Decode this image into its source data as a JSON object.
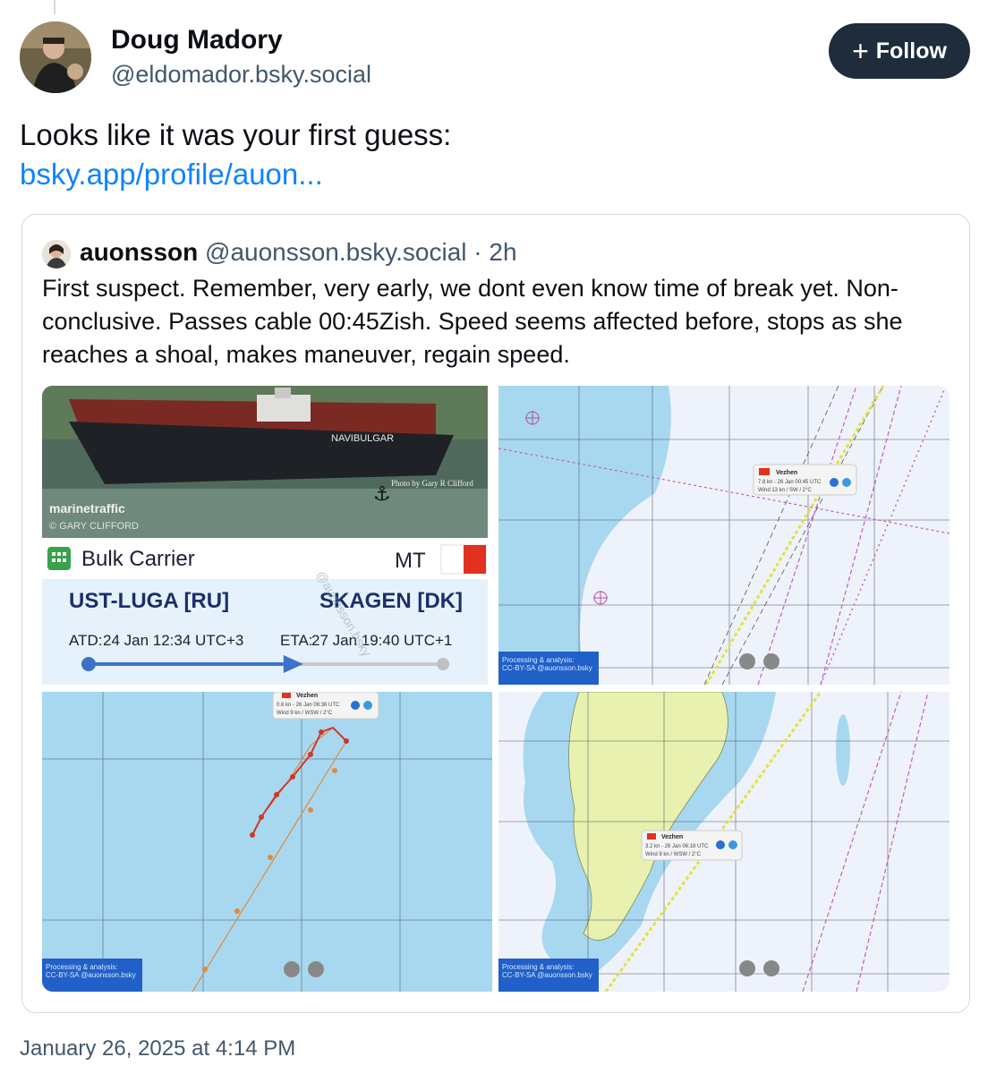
{
  "post": {
    "author_name": "Doug Madory",
    "author_handle": "@eldomador.bsky.social",
    "follow_label": "Follow",
    "text": "Looks like it was your first guess:",
    "link_text": "bsky.app/profile/auon...",
    "timestamp": "January 26, 2025 at 4:14 PM"
  },
  "quote": {
    "author_name": "auonsson",
    "author_handle": "@auonsson.bsky.social",
    "separator": "·",
    "time": "2h",
    "text": "First suspect. Remember, very early, we dont even know time of break yet. Non-conclusive. Passes cable 00:45Zish. Speed seems affected before, stops as she reaches a shoal, makes maneuver, regain speed."
  },
  "images": {
    "ship_card": {
      "watermark": "marinetraffic",
      "photo_credit": "© GARY CLIFFORD",
      "photo_sign": "Photo by Gary R Clifford",
      "hull_name": "NAVIBULGAR",
      "vessel_type": "Bulk Carrier",
      "flag_code": "MT",
      "origin": "UST-LUGA [RU]",
      "destination": "SKAGEN [DK]",
      "atd_label": "ATD:",
      "atd_value": "24 Jan 12:34 UTC+3",
      "eta_label": "ETA:",
      "eta_value": "27 Jan 19:40 UTC+1",
      "overlay_watermark": "@auonsson.bsky",
      "progress": 0.55,
      "flag_color": "#e0321e"
    },
    "map1": {
      "vessel": "Vezhen",
      "line1": "7.8 kn - 26 Jan 00:45 UTC",
      "line2": "Wind 13 kn / SW / 2°C",
      "credit1": "Processing & analysis:",
      "credit2": "CC-BY-SA @auonsson.bsky"
    },
    "map2": {
      "vessel": "Vezhen",
      "line1": "0.6 kn - 26 Jan 06:38 UTC",
      "line2": "Wind 9 kn / WSW / 2°C",
      "credit1": "Processing & analysis:",
      "credit2": "CC-BY-SA @auonsson.bsky"
    },
    "map3": {
      "vessel": "Vezhen",
      "line1": "3.2 kn - 26 Jan 06:18 UTC",
      "line2": "Wind 9 kn / WSW / 2°C",
      "credit1": "Processing & analysis:",
      "credit2": "CC-BY-SA @auonsson.bsky"
    }
  }
}
